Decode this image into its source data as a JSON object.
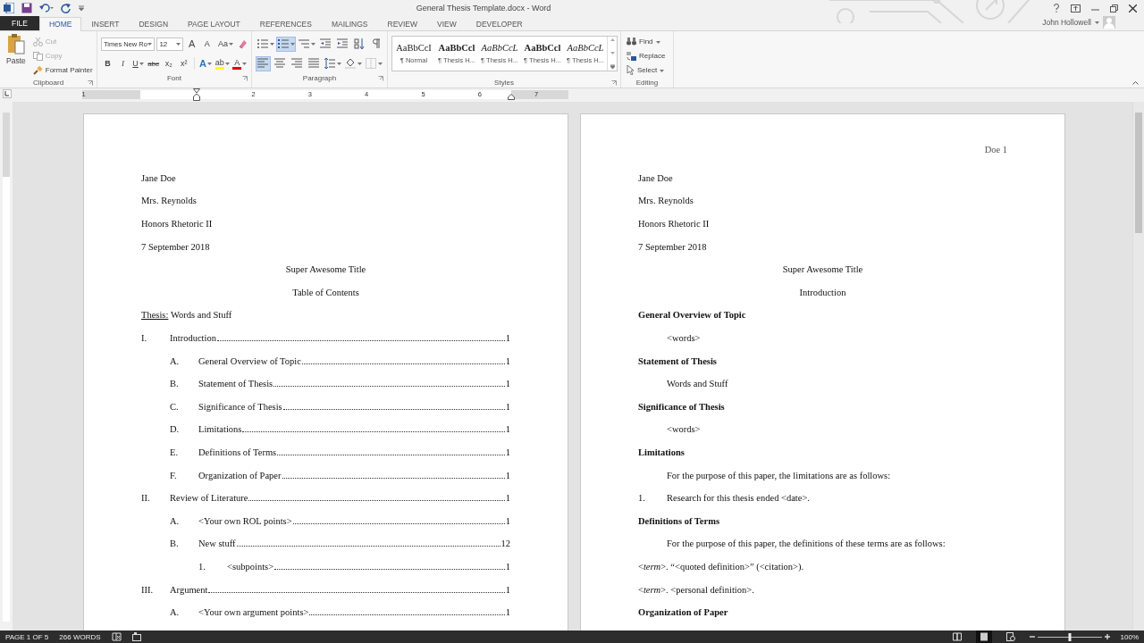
{
  "window": {
    "title": "General Thesis Template.docx - Word",
    "user": "John Hollowell"
  },
  "tabs": [
    {
      "label": "FILE",
      "kind": "file",
      "selected": false
    },
    {
      "label": "HOME",
      "kind": "tab",
      "selected": true
    },
    {
      "label": "INSERT",
      "kind": "tab",
      "selected": false
    },
    {
      "label": "DESIGN",
      "kind": "tab",
      "selected": false
    },
    {
      "label": "PAGE LAYOUT",
      "kind": "tab",
      "selected": false
    },
    {
      "label": "REFERENCES",
      "kind": "tab",
      "selected": false
    },
    {
      "label": "MAILINGS",
      "kind": "tab",
      "selected": false
    },
    {
      "label": "REVIEW",
      "kind": "tab",
      "selected": false
    },
    {
      "label": "VIEW",
      "kind": "tab",
      "selected": false
    },
    {
      "label": "DEVELOPER",
      "kind": "tab",
      "selected": false
    }
  ],
  "clipboard": {
    "label": "Clipboard",
    "paste": "Paste",
    "items": [
      {
        "label": "Cut",
        "kind": "cut",
        "disabled": true
      },
      {
        "label": "Copy",
        "kind": "copy",
        "disabled": true
      },
      {
        "label": "Format Painter",
        "kind": "painter",
        "disabled": false
      }
    ]
  },
  "font": {
    "label": "Font",
    "name": "Times New Ro",
    "size": "12",
    "top_buttons": [
      {
        "label": "A",
        "kind": "grow"
      },
      {
        "label": "A",
        "kind": "shrink"
      },
      {
        "label": "Aa",
        "kind": "case"
      }
    ],
    "format_buttons": [
      {
        "label": "B",
        "kind": "bold"
      },
      {
        "label": "I",
        "kind": "italic"
      },
      {
        "label": "U",
        "kind": "underline"
      },
      {
        "label": "abc",
        "kind": "strike"
      },
      {
        "label": "x₂",
        "kind": "sub"
      },
      {
        "label": "x²",
        "kind": "sup"
      }
    ],
    "color_buttons": [
      {
        "label": "A",
        "kind": "effects"
      },
      {
        "label": "ab",
        "kind": "highlight",
        "color": "#ffff00"
      },
      {
        "label": "A",
        "kind": "fontcolor",
        "color": "#e00000"
      }
    ]
  },
  "paragraph": {
    "label": "Paragraph",
    "row1": [
      {
        "kind": "bullets",
        "selected": false
      },
      {
        "kind": "numbering",
        "selected": true
      },
      {
        "kind": "multilevel",
        "selected": false
      },
      {
        "kind": "outdent",
        "selected": false
      },
      {
        "kind": "indent",
        "selected": false
      },
      {
        "kind": "sort",
        "selected": false
      },
      {
        "kind": "pilcrow",
        "selected": false
      }
    ],
    "row2": [
      {
        "kind": "left",
        "selected": true
      },
      {
        "kind": "center",
        "selected": false
      },
      {
        "kind": "right",
        "selected": false
      },
      {
        "kind": "justify",
        "selected": false
      },
      {
        "kind": "spacing",
        "selected": false
      },
      {
        "kind": "shading",
        "selected": false
      },
      {
        "kind": "borders",
        "selected": false
      }
    ]
  },
  "styles": {
    "label": "Styles",
    "items": [
      {
        "sample": "AaBbCcI",
        "name": "¶ Normal",
        "kind": "normal"
      },
      {
        "sample": "AaBbCcl",
        "name": "¶ Thesis H...",
        "kind": "bold"
      },
      {
        "sample": "AaBbCcL",
        "name": "¶ Thesis H...",
        "kind": "italic"
      },
      {
        "sample": "AaBbCcl",
        "name": "¶ Thesis H...",
        "kind": "bold"
      },
      {
        "sample": "AaBbCcL",
        "name": "¶ Thesis H...",
        "kind": "italic"
      }
    ]
  },
  "editing": {
    "label": "Editing",
    "items": [
      {
        "label": "Find",
        "kind": "find"
      },
      {
        "label": "Replace",
        "kind": "replace"
      },
      {
        "label": "Select",
        "kind": "select"
      }
    ]
  },
  "ruler": {
    "labels": [
      "1",
      "2",
      "3",
      "4",
      "5",
      "6",
      "7"
    ]
  },
  "pages": [
    {
      "blocks": [
        {
          "kind": "plain",
          "text": "Jane Doe"
        },
        {
          "kind": "plain",
          "text": "Mrs. Reynolds"
        },
        {
          "kind": "plain",
          "text": "Honors Rhetoric II"
        },
        {
          "kind": "plain",
          "text": "7 September 2018"
        },
        {
          "kind": "center",
          "text": "Super Awesome Title"
        },
        {
          "kind": "center",
          "text": "Table of Contents"
        },
        {
          "kind": "thesis",
          "label": "Thesis:",
          "text": "Words and Stuff"
        },
        {
          "kind": "toc",
          "entries": [
            {
              "marker": "I.",
              "text": "Introduction",
              "page": "1",
              "children": [
                {
                  "marker": "A.",
                  "text": "General Overview of Topic",
                  "page": "1"
                },
                {
                  "marker": "B.",
                  "text": "Statement of Thesis",
                  "page": "1"
                },
                {
                  "marker": "C.",
                  "text": "Significance of Thesis",
                  "page": "1"
                },
                {
                  "marker": "D.",
                  "text": "Limitations",
                  "page": "1"
                },
                {
                  "marker": "E.",
                  "text": "Definitions of Terms",
                  "page": "1"
                },
                {
                  "marker": "F.",
                  "text": "Organization of Paper",
                  "page": "1"
                }
              ]
            },
            {
              "marker": "II.",
              "text": "Review of Literature",
              "page": "1",
              "children": [
                {
                  "marker": "A.",
                  "text": "<Your own ROL points>",
                  "page": "1"
                },
                {
                  "marker": "B.",
                  "text": "New stuff",
                  "page": "12",
                  "children": [
                    {
                      "marker": "1.",
                      "text": "<subpoints>",
                      "page": "1"
                    }
                  ]
                }
              ]
            },
            {
              "marker": "III.",
              "text": "Argument",
              "page": "1",
              "children": [
                {
                  "marker": "A.",
                  "text": "<Your own argument points>",
                  "page": "1"
                }
              ]
            }
          ]
        }
      ]
    },
    {
      "header": "Doe 1",
      "blocks": [
        {
          "kind": "plain",
          "text": "Jane Doe"
        },
        {
          "kind": "plain",
          "text": "Mrs. Reynolds"
        },
        {
          "kind": "plain",
          "text": "Honors Rhetoric II"
        },
        {
          "kind": "plain",
          "text": "7 September 2018"
        },
        {
          "kind": "center",
          "text": "Super Awesome Title"
        },
        {
          "kind": "center",
          "text": "Introduction"
        },
        {
          "kind": "heading",
          "text": "General Overview of Topic"
        },
        {
          "kind": "indent",
          "text": "<words>"
        },
        {
          "kind": "heading",
          "text": "Statement of Thesis"
        },
        {
          "kind": "indent",
          "text": "Words and Stuff"
        },
        {
          "kind": "heading",
          "text": "Significance of Thesis"
        },
        {
          "kind": "indent",
          "text": "<words>"
        },
        {
          "kind": "heading",
          "text": "Limitations"
        },
        {
          "kind": "indent",
          "text": "For the purpose of this paper, the limitations are as follows:"
        },
        {
          "kind": "numbered",
          "marker": "1.",
          "text": "Research for this thesis ended <date>."
        },
        {
          "kind": "heading",
          "text": "Definitions of Terms"
        },
        {
          "kind": "indent",
          "text": "For the purpose of this paper, the definitions of these terms are as follows:"
        },
        {
          "kind": "plain",
          "text": "<*term*>. “<quoted definition>” (<citation>)."
        },
        {
          "kind": "plain",
          "text": "<*term*>. <personal definition>."
        },
        {
          "kind": "heading",
          "text": "Organization of Paper"
        }
      ]
    }
  ],
  "status": {
    "page": "PAGE 1 OF 5",
    "words": "266 WORDS",
    "zoom": "100%",
    "zoom_slider": {
      "level": 0.5
    },
    "views": [
      {
        "kind": "read",
        "selected": false
      },
      {
        "kind": "print",
        "selected": true
      },
      {
        "kind": "web",
        "selected": false
      }
    ]
  }
}
